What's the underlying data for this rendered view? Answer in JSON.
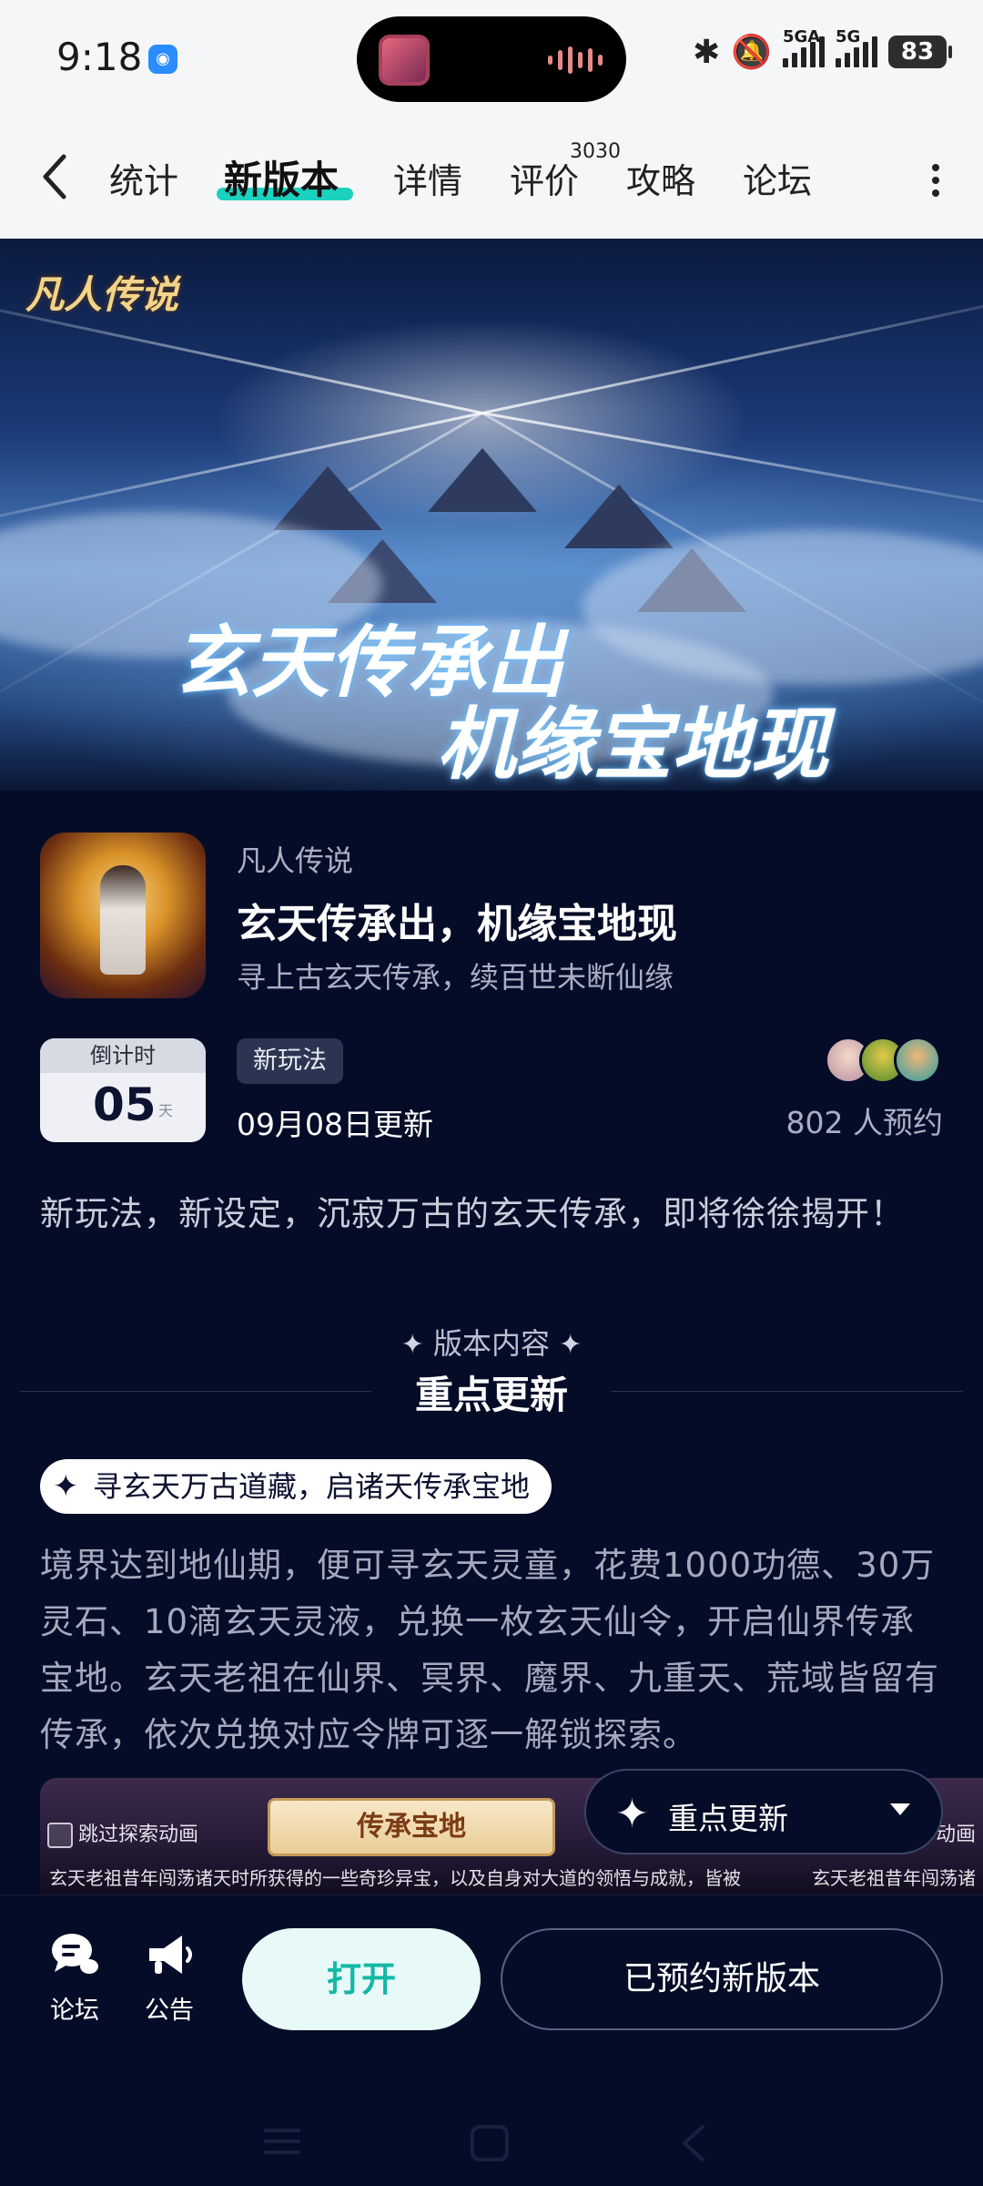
{
  "status_bar": {
    "time": "9:18",
    "network_labels": [
      "5GA",
      "5G"
    ],
    "battery": "83"
  },
  "nav": {
    "tabs": [
      {
        "label": "统计",
        "active": false
      },
      {
        "label": "新版本",
        "active": true
      },
      {
        "label": "详情",
        "active": false
      },
      {
        "label": "评价",
        "active": false
      },
      {
        "label": "攻略",
        "active": false
      },
      {
        "label": "论坛",
        "active": false
      }
    ],
    "review_count": "3030",
    "accent_color": "#1bd2c0"
  },
  "banner": {
    "logo_text": "凡人传说",
    "line1": "玄天传承出",
    "line2": "机缘宝地现"
  },
  "info": {
    "game_name": "凡人传说",
    "title": "玄天传承出，机缘宝地现",
    "subtitle": "寻上古玄天传承，续百世未断仙缘",
    "countdown_label": "倒计时",
    "countdown_days": "05",
    "countdown_unit": "天",
    "tag": "新玩法",
    "update_date": "09月08日更新",
    "reservations": "802 人预约",
    "summary": "新玩法，新设定，沉寂万古的玄天传承，即将徐徐揭开！"
  },
  "section": {
    "kicker": "版本内容",
    "title": "重点更新"
  },
  "content": {
    "highlight": "寻玄天万古道藏，启诸天传承宝地",
    "body": "境界达到地仙期，便可寻玄天灵童，花费1000功德、30万灵石、10滴玄天灵液，兑换一枚玄天仙令，开启仙界传承宝地。玄天老祖在仙界、冥界、魔界、九重天、荒域皆留有传承，依次兑换对应令牌可逐一解锁探索。"
  },
  "preview": {
    "skip_label": "跳过探索动画",
    "scroll_title": "传承宝地",
    "caption": "玄天老祖昔年闯荡诸天时所获得的一些奇珍异宝，以及自身对大道的领悟与成就，皆被",
    "caption_right": "玄天老祖昔年闯荡诸",
    "skip_label_right": "动画"
  },
  "floating": {
    "label": "重点更新"
  },
  "bottom_bar": {
    "forum": "论坛",
    "notice": "公告",
    "open": "打开",
    "reserved": "已预约新版本"
  }
}
